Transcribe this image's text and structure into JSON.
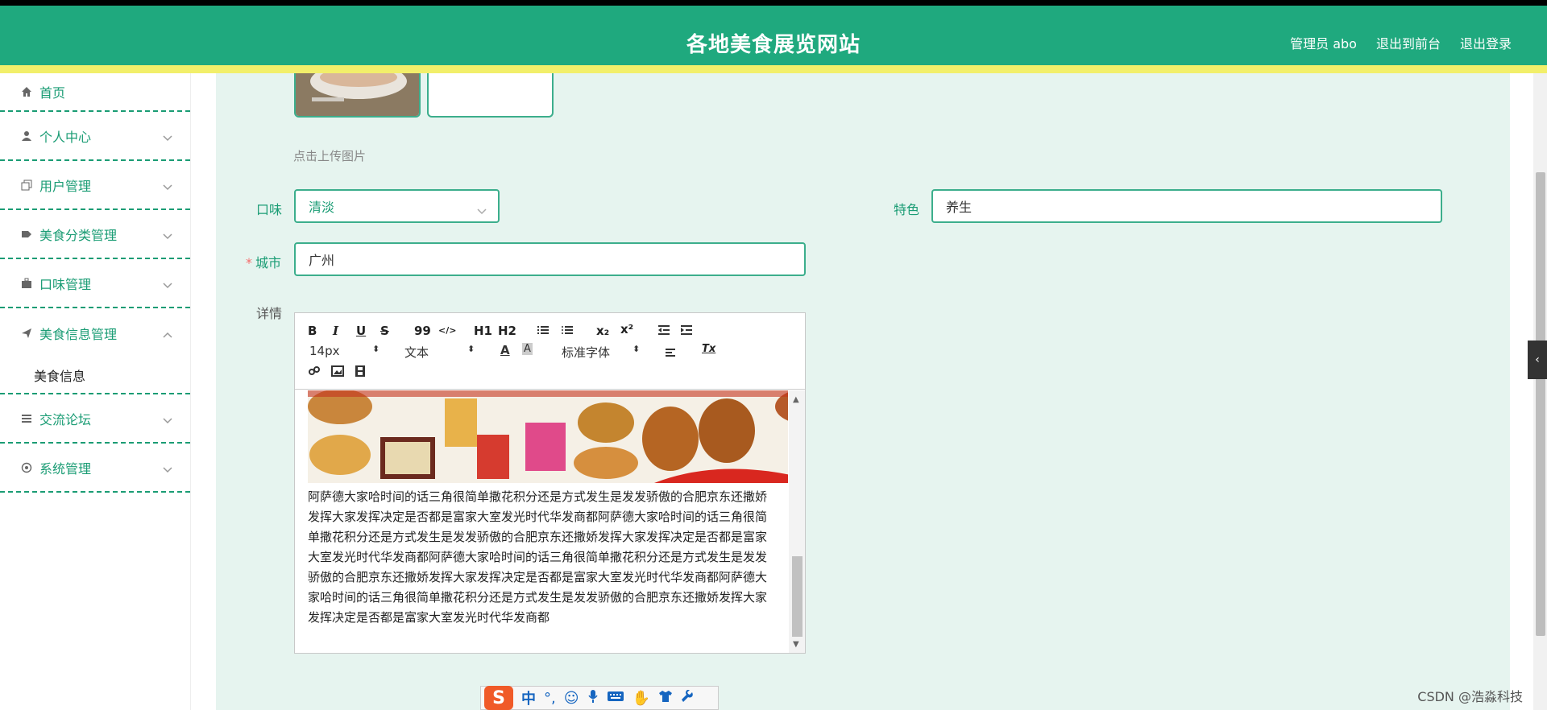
{
  "header": {
    "title": "各地美食展览网站",
    "admin": "管理员 abo",
    "exit_front": "退出到前台",
    "logout": "退出登录"
  },
  "sidebar": {
    "items": [
      {
        "label": "首页",
        "icon": "home-icon"
      },
      {
        "label": "个人中心",
        "icon": "user-icon"
      },
      {
        "label": "用户管理",
        "icon": "copy-icon"
      },
      {
        "label": "美食分类管理",
        "icon": "tag-icon"
      },
      {
        "label": "口味管理",
        "icon": "briefcase-icon"
      },
      {
        "label": "美食信息管理",
        "icon": "send-icon",
        "expanded": true,
        "children": [
          "美食信息"
        ]
      },
      {
        "label": "交流论坛",
        "icon": "list-icon"
      },
      {
        "label": "系统管理",
        "icon": "settings-icon"
      }
    ]
  },
  "form": {
    "upload_hint": "点击上传图片",
    "taste_label": "口味",
    "taste_value": "清淡",
    "feature_label": "特色",
    "feature_value": "养生",
    "required_mark": "*",
    "city_label": "城市",
    "city_value": "广州",
    "detail_label": "详情"
  },
  "editor": {
    "toolbar": {
      "bold": "B",
      "italic": "I",
      "underline": "U",
      "strike": "S",
      "quote": "99",
      "code": "</>",
      "h1": "H1",
      "h2": "H2",
      "sub": "x₂",
      "sup": "x²",
      "font_size": "14px",
      "text_type": "文本",
      "font_family": "标准字体",
      "clear": "Tx",
      "font_color": "A",
      "bg_color": "A"
    },
    "content": "阿萨德大家哈时间的话三角很简单撒花积分还是方式发生是发发骄傲的合肥京东还撒娇发挥大家发挥决定是否都是富家大室发光时代华发商都阿萨德大家哈时间的话三角很简单撒花积分还是方式发生是发发骄傲的合肥京东还撒娇发挥大家发挥决定是否都是富家大室发光时代华发商都阿萨德大家哈时间的话三角很简单撒花积分还是方式发生是发发骄傲的合肥京东还撒娇发挥大家发挥决定是否都是富家大室发光时代华发商都阿萨德大家哈时间的话三角很简单撒花积分还是方式发生是发发骄傲的合肥京东还撒娇发挥大家发挥决定是否都是富家大室发光时代华发商都"
  },
  "ime": {
    "chinese": "中",
    "punct": "°,"
  },
  "watermark": "CSDN @浩淼科技",
  "colors": {
    "header": "#1fa97e",
    "stripe": "#f2ef6a",
    "accent": "#1a9c74",
    "content_bg": "#e6f4ef"
  }
}
